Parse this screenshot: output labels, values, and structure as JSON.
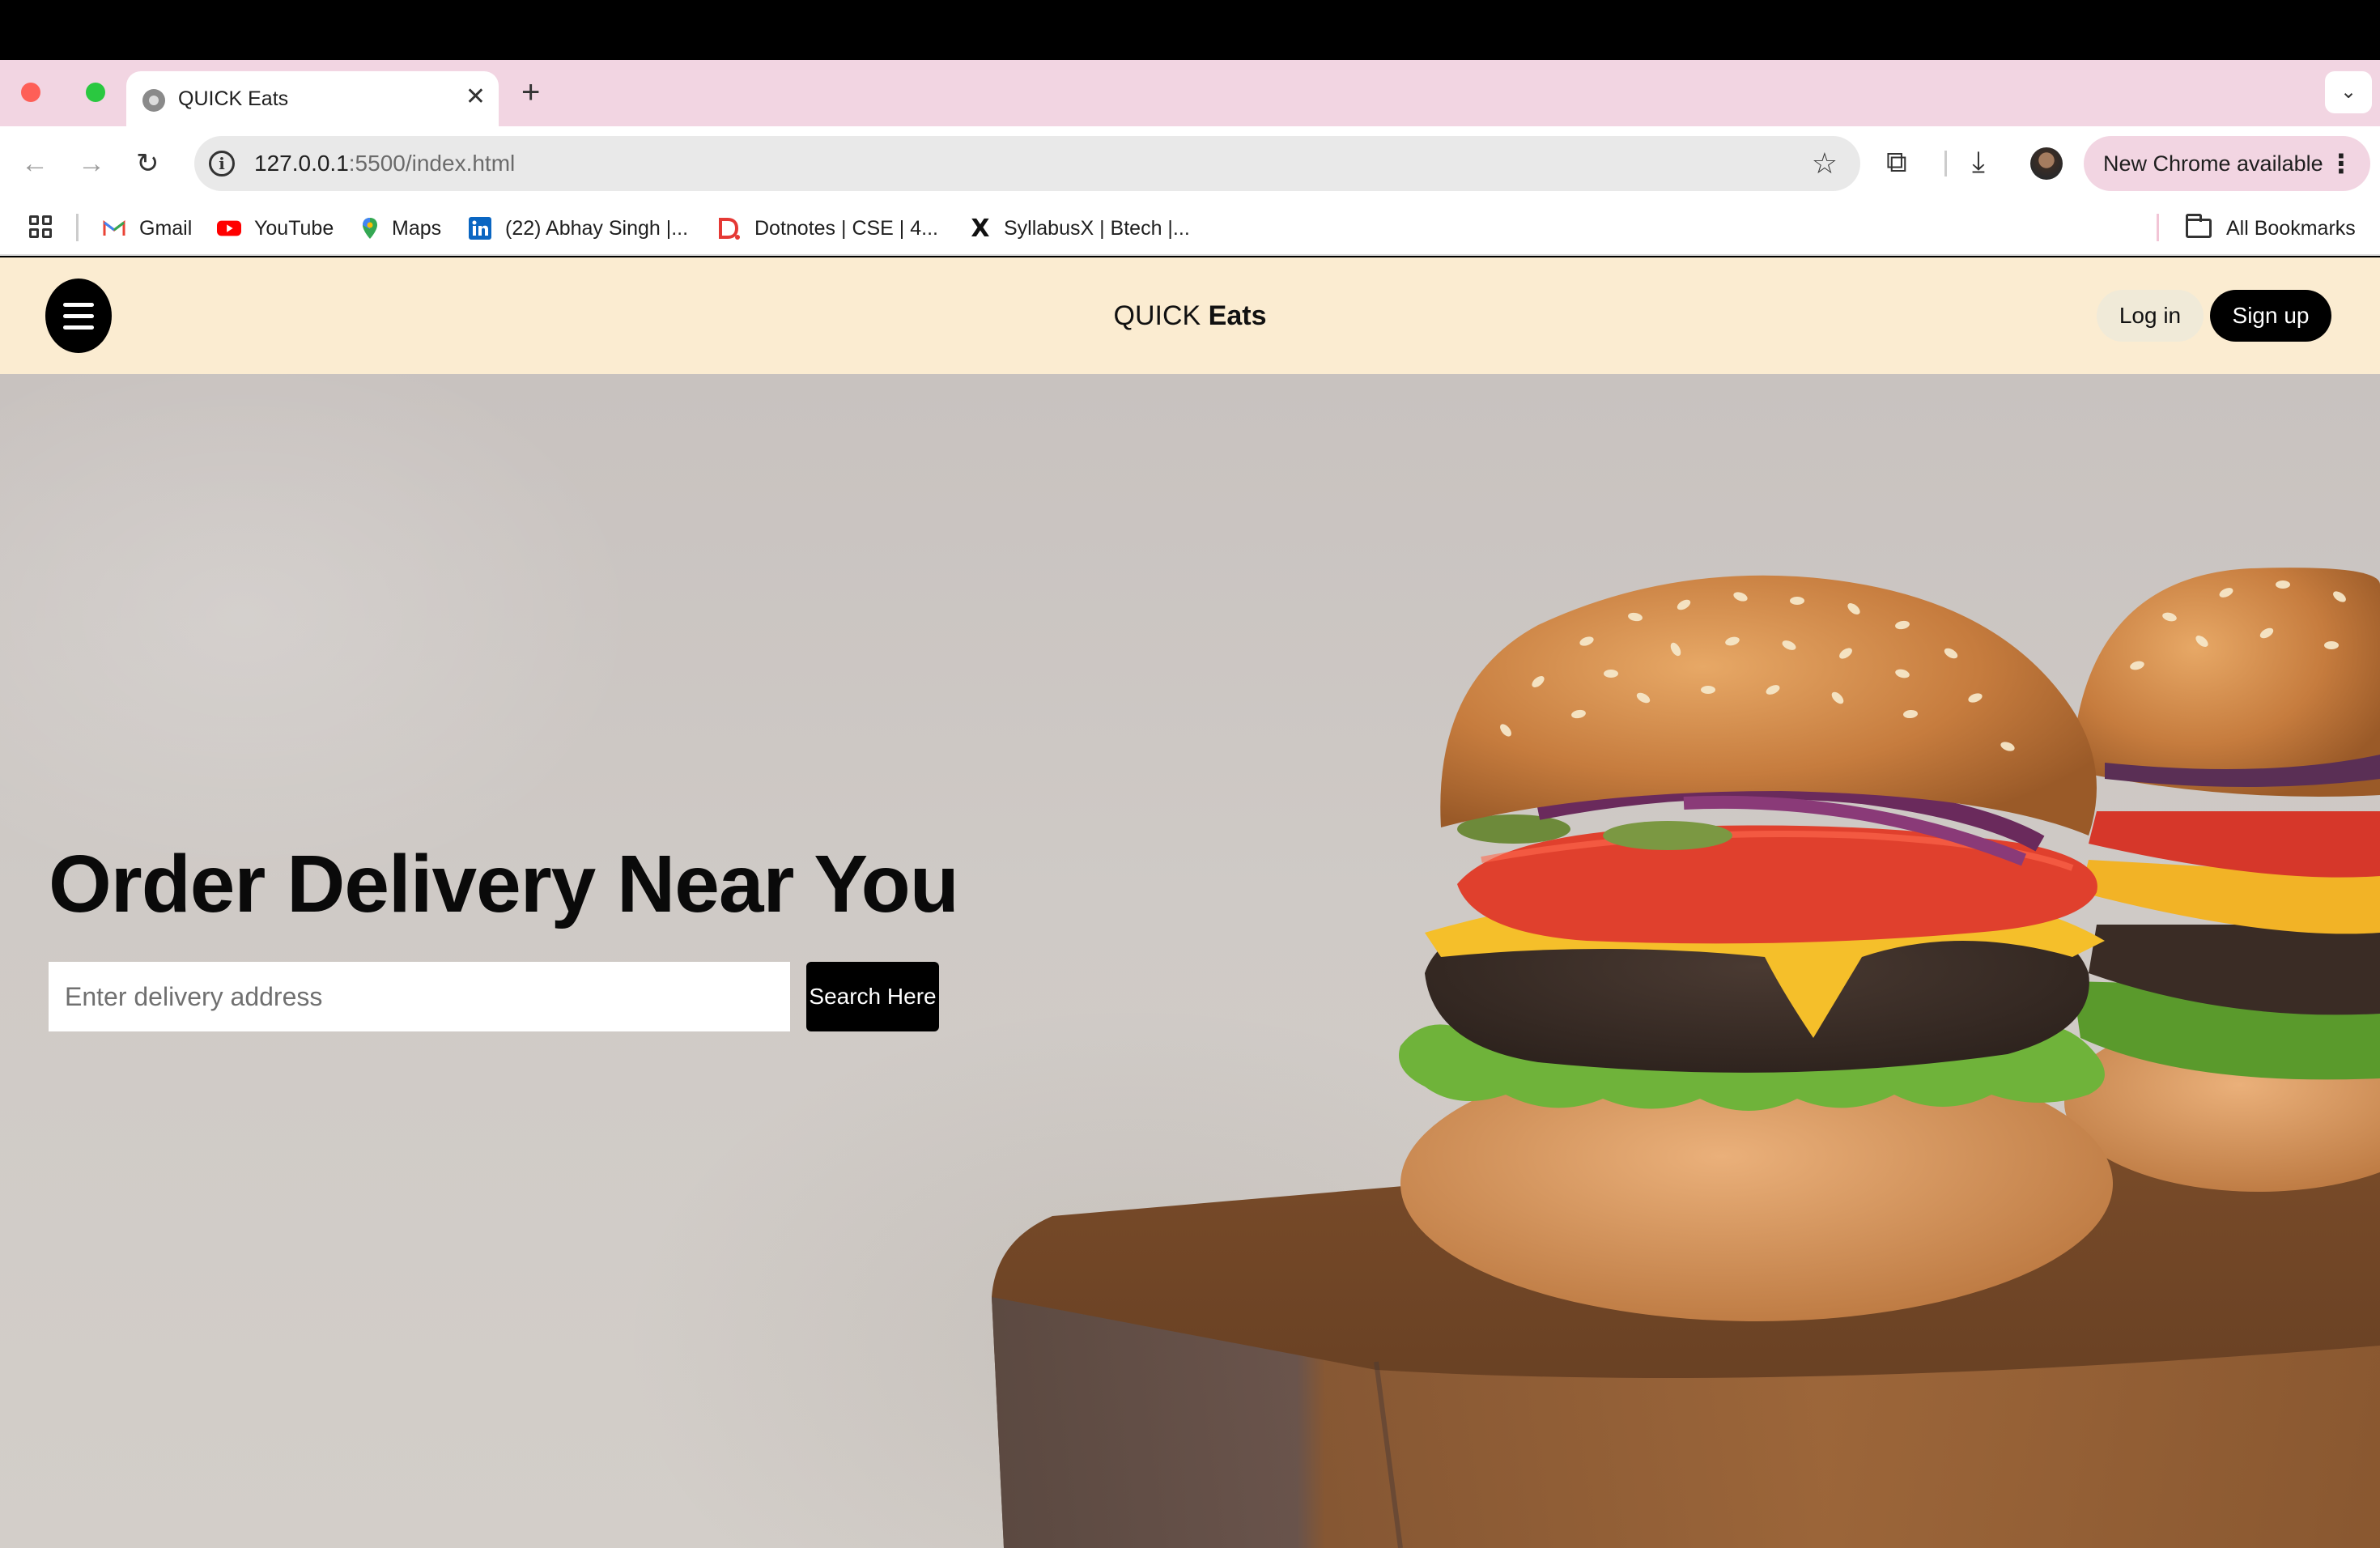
{
  "browser": {
    "tab_title": "QUICK Eats",
    "url_host": "127.0.0.1",
    "url_path": ":5500/index.html",
    "update_label": "New Chrome available",
    "bookmarks": [
      {
        "label": "Gmail",
        "icon": "gmail-icon"
      },
      {
        "label": "YouTube",
        "icon": "youtube-icon"
      },
      {
        "label": "Maps",
        "icon": "maps-icon"
      },
      {
        "label": "(22) Abhay Singh |...",
        "icon": "linkedin-icon"
      },
      {
        "label": "Dotnotes | CSE | 4...",
        "icon": "dotnotes-icon"
      },
      {
        "label": "SyllabusX | Btech |...",
        "icon": "x-icon"
      }
    ],
    "all_bookmarks_label": "All Bookmarks"
  },
  "site": {
    "logo_light": "QUICK",
    "logo_bold": "Eats",
    "login_label": "Log in",
    "signup_label": "Sign up",
    "brand_bg": "#fbecd1"
  },
  "hero": {
    "title": "Order Delivery Near You",
    "address_placeholder": "Enter delivery address",
    "search_label": "Search Here",
    "image": "burger-photo"
  }
}
